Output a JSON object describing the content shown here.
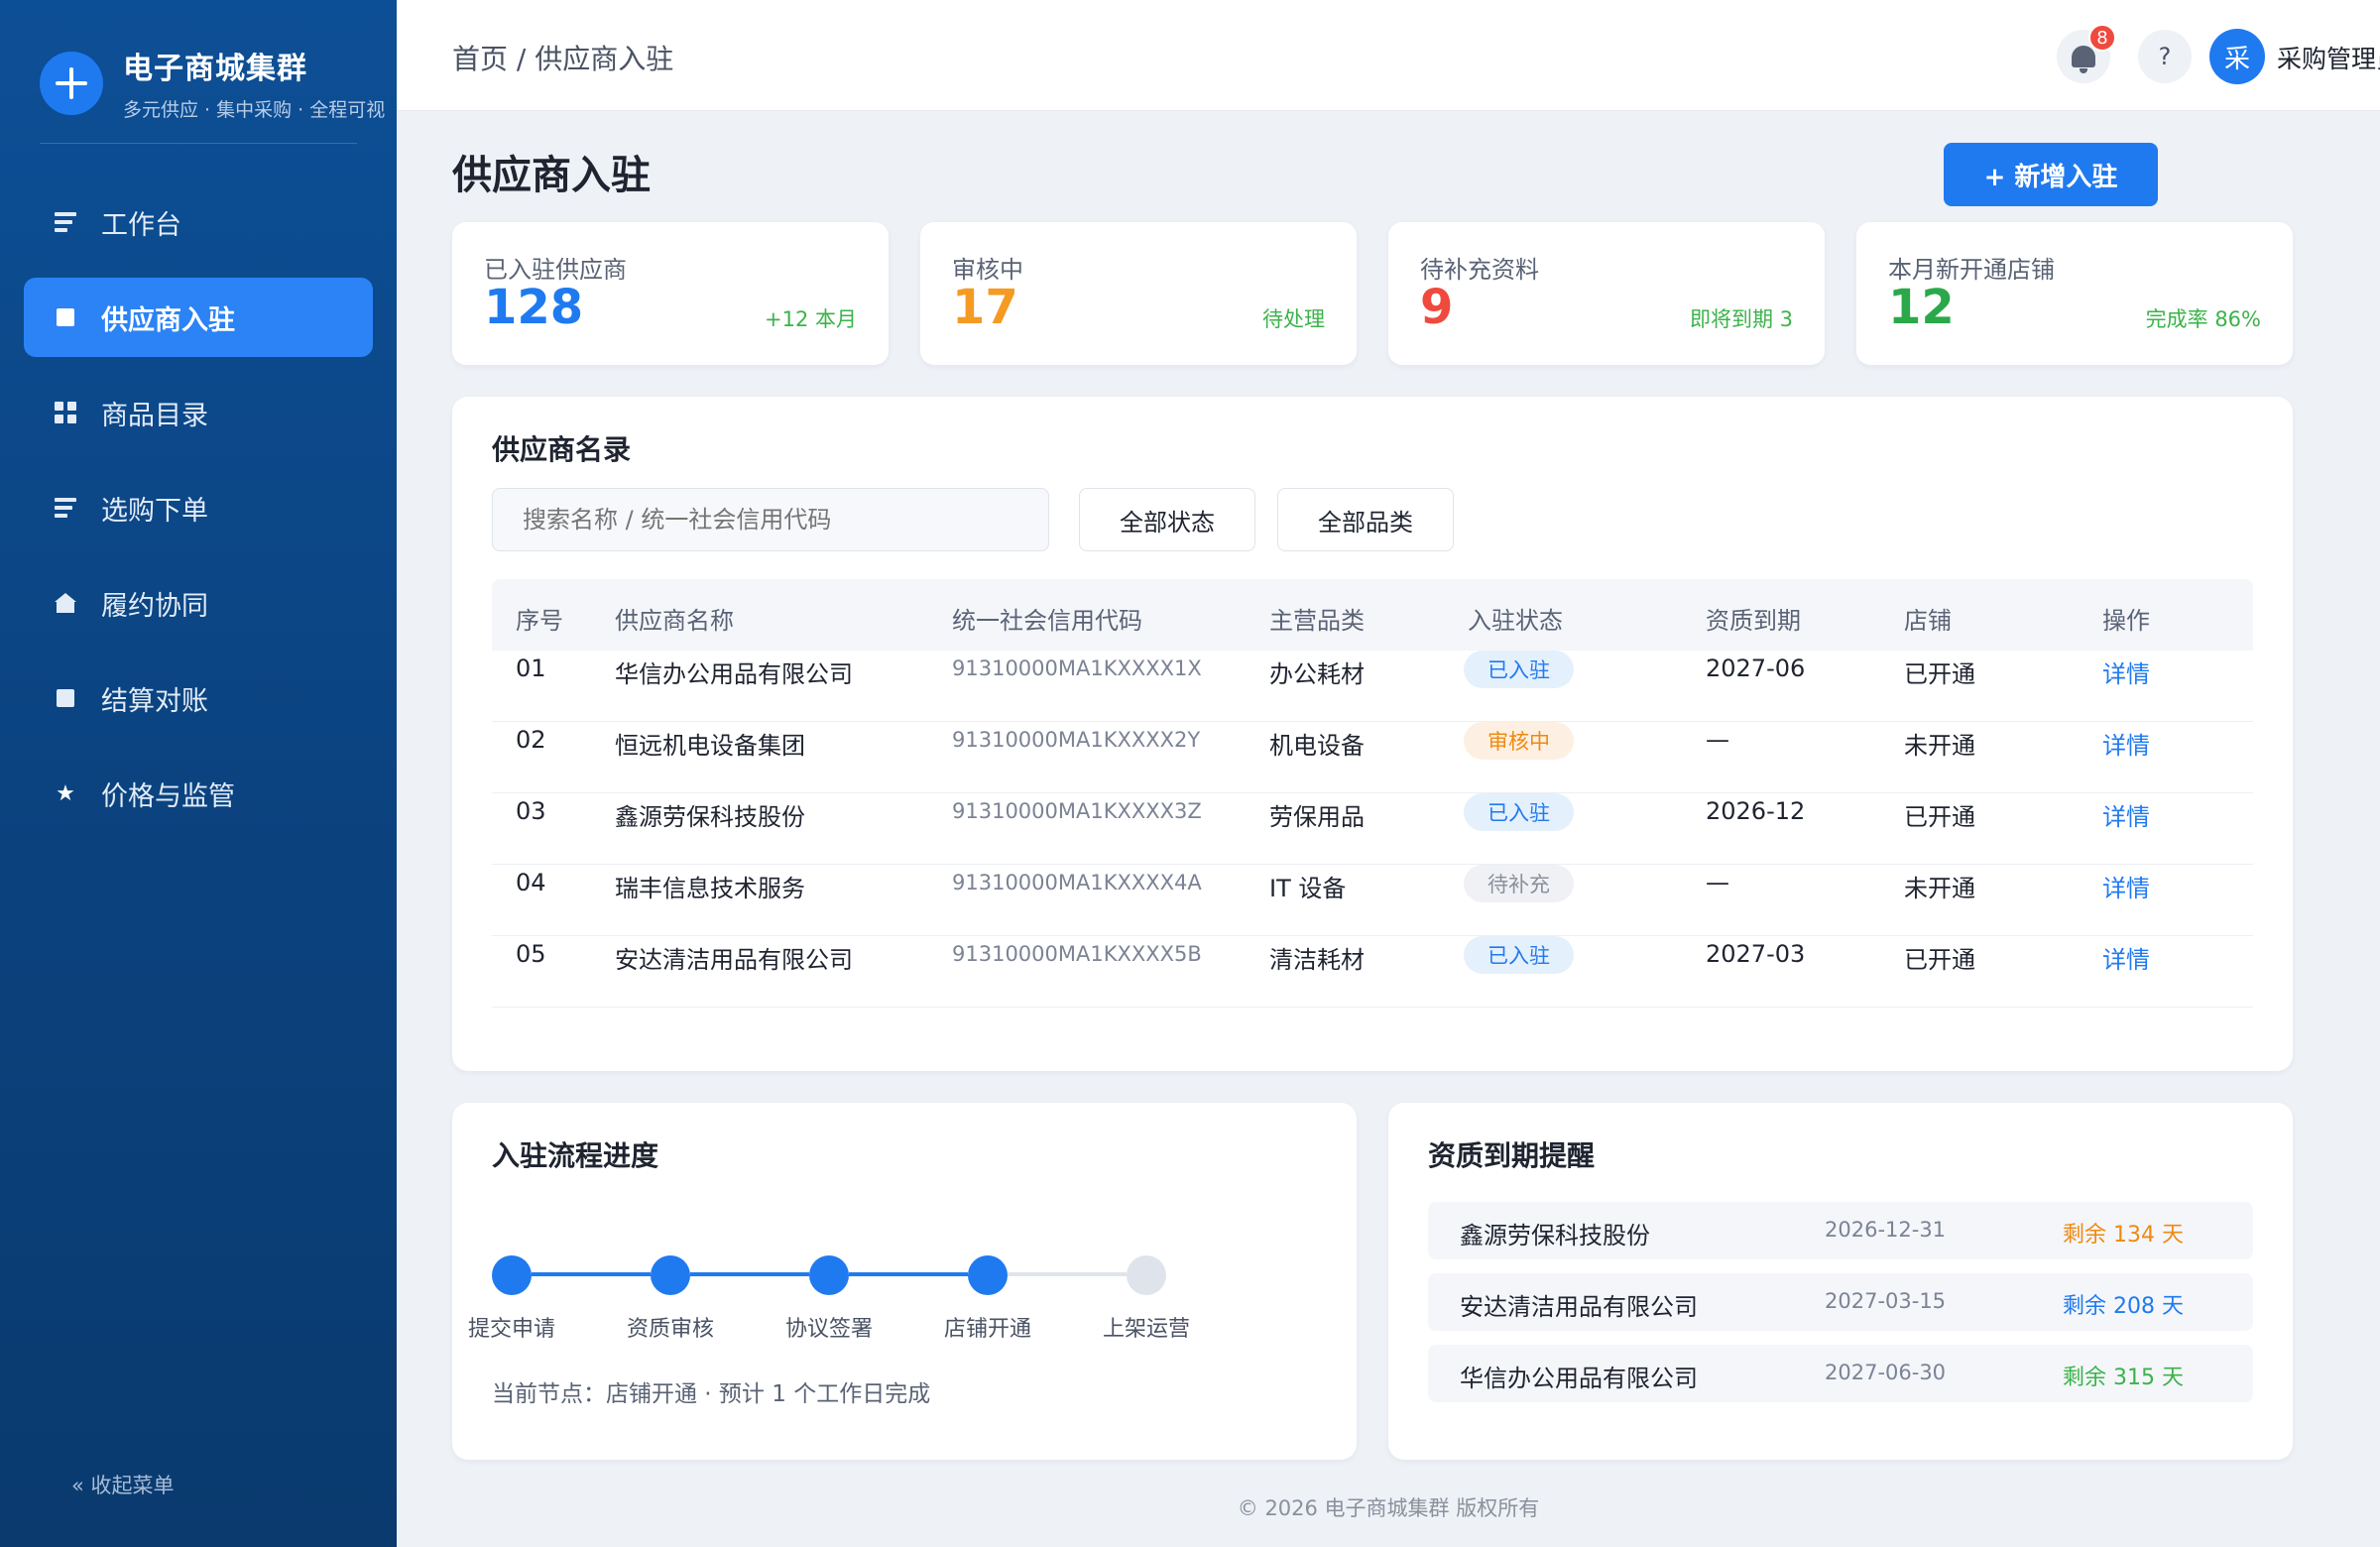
{
  "brand": {
    "title": "电子商城集群",
    "subtitle": "多元供应 · 集中采购 · 全程可视"
  },
  "sidebar": {
    "items": [
      {
        "label": "工作台",
        "icon": "dashboard-icon",
        "active": false
      },
      {
        "label": "供应商入驻",
        "icon": "supplier-icon",
        "active": true
      },
      {
        "label": "商品目录",
        "icon": "catalog-icon",
        "active": false
      },
      {
        "label": "选购下单",
        "icon": "order-icon",
        "active": false
      },
      {
        "label": "履约协同",
        "icon": "fulfillment-icon",
        "active": false
      },
      {
        "label": "结算对账",
        "icon": "settlement-icon",
        "active": false
      },
      {
        "label": "价格与监管",
        "icon": "star-icon",
        "active": false
      }
    ],
    "collapse_label": "« 收起菜单"
  },
  "header": {
    "breadcrumb": "首页 / 供应商入驻",
    "notification_count": "8",
    "help_label": "?",
    "avatar_initial": "采",
    "user_name": "采购管理员"
  },
  "page": {
    "title": "供应商入驻",
    "primary_action": "+ 新增入驻"
  },
  "stats": [
    {
      "label": "已入驻供应商",
      "value": "128",
      "note": "+12 本月",
      "value_color": "#1f7af0",
      "note_color": "#3bb34a"
    },
    {
      "label": "审核中",
      "value": "17",
      "note": "待处理",
      "value_color": "#f59a23",
      "note_color": "#3bb34a"
    },
    {
      "label": "待补充资料",
      "value": "9",
      "note": "即将到期 3",
      "value_color": "#f0493e",
      "note_color": "#3bb34a"
    },
    {
      "label": "本月新开通店铺",
      "value": "12",
      "note": "完成率 86%",
      "value_color": "#2aa84a",
      "note_color": "#3bb34a"
    }
  ],
  "directory": {
    "title": "供应商名录",
    "search_placeholder": "搜索名称 / 统一社会信用代码",
    "filter_status": "全部状态",
    "filter_category": "全部品类",
    "columns": [
      "序号",
      "供应商名称",
      "统一社会信用代码",
      "主营品类",
      "入驻状态",
      "资质到期",
      "店铺",
      "操作"
    ],
    "rows": [
      {
        "no": "01",
        "name": "华信办公用品有限公司",
        "code": "91310000MA1KXXXX1X",
        "category": "办公耗材",
        "status": "已入驻",
        "status_type": "ok",
        "expiry": "2027-06",
        "shop": "已开通",
        "action": "详情"
      },
      {
        "no": "02",
        "name": "恒远机电设备集团",
        "code": "91310000MA1KXXXX2Y",
        "category": "机电设备",
        "status": "审核中",
        "status_type": "wait",
        "expiry": "—",
        "shop": "未开通",
        "action": "详情"
      },
      {
        "no": "03",
        "name": "鑫源劳保科技股份",
        "code": "91310000MA1KXXXX3Z",
        "category": "劳保用品",
        "status": "已入驻",
        "status_type": "ok",
        "expiry": "2026-12",
        "shop": "已开通",
        "action": "详情"
      },
      {
        "no": "04",
        "name": "瑞丰信息技术服务",
        "code": "91310000MA1KXXXX4A",
        "category": "IT 设备",
        "status": "待补充",
        "status_type": "pend",
        "expiry": "—",
        "shop": "未开通",
        "action": "详情"
      },
      {
        "no": "05",
        "name": "安达清洁用品有限公司",
        "code": "91310000MA1KXXXX5B",
        "category": "清洁耗材",
        "status": "已入驻",
        "status_type": "ok",
        "expiry": "2027-03",
        "shop": "已开通",
        "action": "详情"
      }
    ]
  },
  "progress": {
    "title": "入驻流程进度",
    "steps": [
      {
        "label": "提交申请",
        "done": true
      },
      {
        "label": "资质审核",
        "done": true
      },
      {
        "label": "协议签署",
        "done": true
      },
      {
        "label": "店铺开通",
        "done": true
      },
      {
        "label": "上架运营",
        "done": false
      }
    ],
    "current_note": "当前节点：店铺开通 · 预计 1 个工作日完成"
  },
  "expiry": {
    "title": "资质到期提醒",
    "items": [
      {
        "name": "鑫源劳保科技股份",
        "date": "2026-12-31",
        "remaining": "剩余 134 天",
        "color": "#ee8a12"
      },
      {
        "name": "安达清洁用品有限公司",
        "date": "2027-03-15",
        "remaining": "剩余 208 天",
        "color": "#1f7af0"
      },
      {
        "name": "华信办公用品有限公司",
        "date": "2027-06-30",
        "remaining": "剩余 315 天",
        "color": "#3bb34a"
      }
    ]
  },
  "footer": {
    "text": "© 2026 电子商城集群 版权所有"
  }
}
